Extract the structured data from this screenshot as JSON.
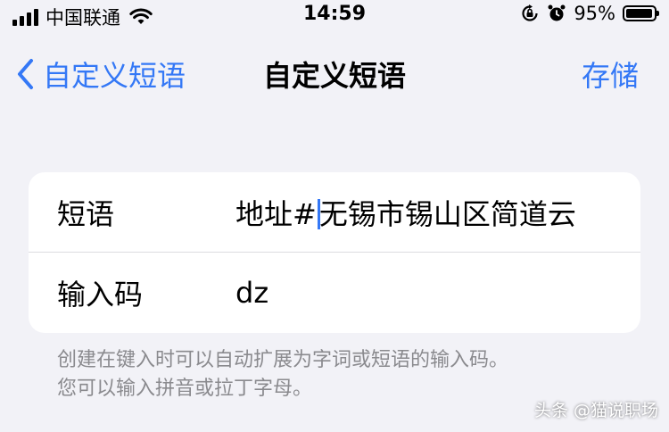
{
  "status_bar": {
    "carrier": "中国联通",
    "time": "14:59",
    "battery_percent": "95%",
    "battery_level": 0.95
  },
  "nav": {
    "back_label": "自定义短语",
    "title": "自定义短语",
    "save_label": "存储"
  },
  "form": {
    "phrase_label": "短语",
    "phrase_value_before_cursor": "地址#",
    "phrase_value_after_cursor": "无锡市锡山区简道云",
    "shortcut_label": "输入码",
    "shortcut_value": "dz"
  },
  "footnote": {
    "line1": "创建在键入时可以自动扩展为字词或短语的输入码。",
    "line2": "您可以输入拼音或拉丁字母。"
  },
  "watermark": "头条 @猫说职场",
  "colors": {
    "accent": "#3478f6",
    "background": "#f2f2f7",
    "secondary_text": "#8a8a8e"
  }
}
